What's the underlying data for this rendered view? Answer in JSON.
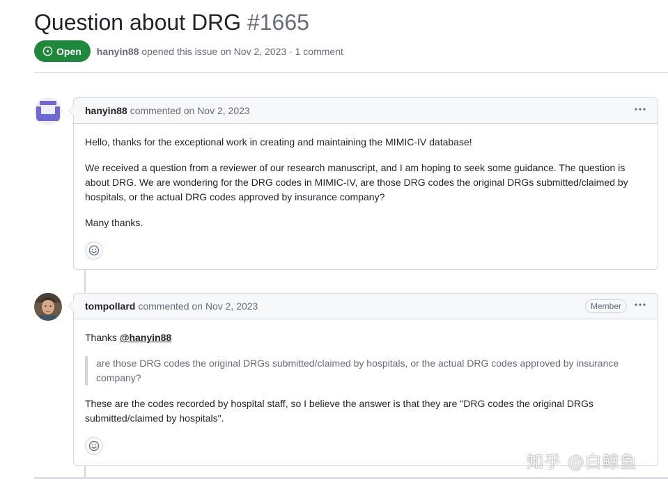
{
  "issue": {
    "title": "Question about DRG",
    "number": "#1665",
    "state": "Open",
    "author": "hanyin88",
    "opened_text": "opened this issue on Nov 2, 2023 · 1 comment"
  },
  "colors": {
    "open_badge": "#1f883d",
    "border": "#d0d7de",
    "header_bg": "#f6f8fa",
    "muted_text": "#656d76"
  },
  "comments": [
    {
      "author": "hanyin88",
      "action": "commented on Nov 2, 2023",
      "role": "",
      "avatar_icon": "identicon-avatar",
      "paragraphs": [
        "Hello, thanks for the exceptional work in creating and maintaining the MIMIC-IV database!",
        "We received a question from a reviewer of our research manuscript, and I am hoping to seek some guidance. The question is about DRG. We are wondering for the DRG codes in MIMIC-IV, are those DRG codes the original DRGs submitted/claimed by hospitals, or the actual DRG codes approved by insurance company?",
        "Many thanks."
      ],
      "menu_icon": "kebab-horizontal-icon",
      "reaction_icon": "smiley-icon"
    },
    {
      "author": "tompollard",
      "action": "commented on Nov 2, 2023",
      "role": "Member",
      "avatar_icon": "photo-avatar",
      "greeting": "Thanks",
      "mention": "@hanyin88",
      "quote": "are those DRG codes the original DRGs submitted/claimed by hospitals, or the actual DRG codes approved by insurance company?",
      "answer": "These are the codes recorded by hospital staff, so I believe the answer is that they are \"DRG codes the original DRGs submitted/claimed by hospitals\".",
      "menu_icon": "kebab-horizontal-icon",
      "reaction_icon": "smiley-icon"
    }
  ],
  "watermark": "知乎 @白鲸鱼"
}
